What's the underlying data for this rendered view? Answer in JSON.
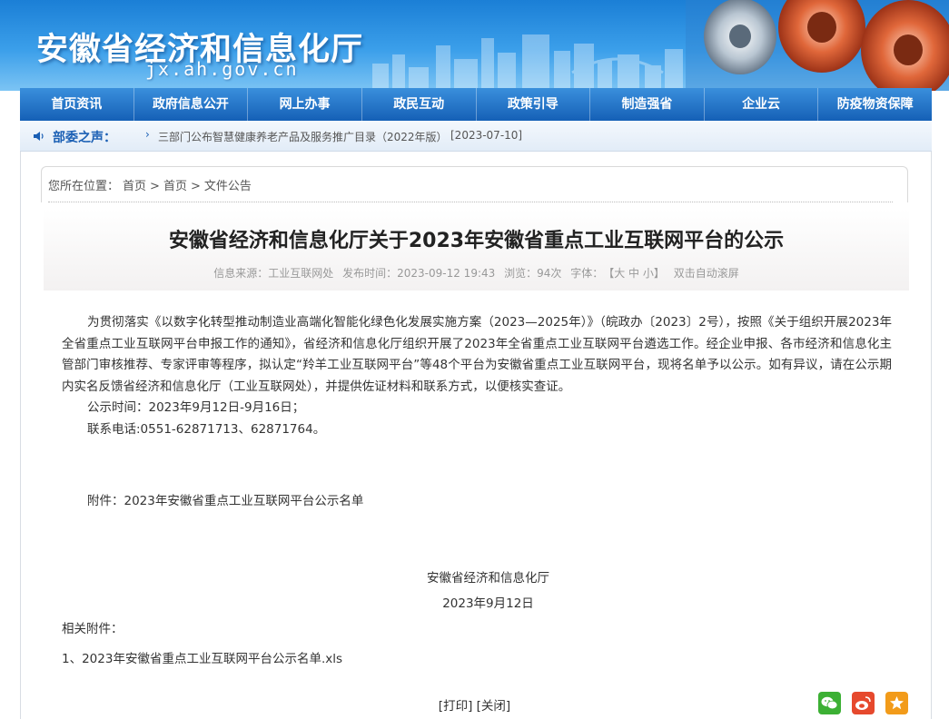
{
  "header": {
    "site_title": "安徽省经济和信息化厅",
    "domain": "jx.ah.gov.cn"
  },
  "nav": {
    "items": [
      "首页资讯",
      "政府信息公开",
      "网上办事",
      "政民互动",
      "政策引导",
      "制造强省",
      "企业云",
      "防疫物资保障"
    ]
  },
  "voice": {
    "label": "部委之声：",
    "arrow": "›",
    "text": "三部门公布智慧健康养老产品及服务推广目录（2022年版）",
    "date": "[2023-07-10]"
  },
  "breadcrumb": {
    "prefix": "您所在位置：",
    "items": [
      "首页",
      "首页",
      "文件公告"
    ],
    "separator": ">"
  },
  "article": {
    "title": "安徽省经济和信息化厅关于2023年安徽省重点工业互联网平台的公示",
    "meta": {
      "source": "信息来源：工业互联网处",
      "published": "发布时间：2023-09-12 19:43",
      "views": "浏览：94次",
      "font_label": "字体：",
      "font_sizes": "【大 中 小】",
      "autoscroll": "双击自动滚屏"
    },
    "paragraph1": "为贯彻落实《以数字化转型推动制造业高端化智能化绿色化发展实施方案（2023—2025年）》（皖政办〔2023〕2号），按照《关于组织开展2023年全省重点工业互联网平台申报工作的通知》，省经济和信息化厅组织开展了2023年全省重点工业互联网平台遴选工作。经企业申报、各市经济和信息化主管部门审核推荐、专家评审等程序，拟认定“羚羊工业互联网平台”等48个平台为安徽省重点工业互联网平台，现将名单予以公示。如有异议，请在公示期内实名反馈省经济和信息化厅（工业互联网处），并提供佐证材料和联系方式，以便核实查证。",
    "period": "公示时间：2023年9月12日-9月16日；",
    "phone": "联系电话:0551-62871713、62871764。",
    "attachment": "附件：2023年安徽省重点工业互联网平台公示名单",
    "sign_org": "安徽省经济和信息化厅",
    "sign_date": "2023年9月12日",
    "related_label": "相关附件：",
    "related_file": "1、2023年安徽省重点工业互联网平台公示名单.xls"
  },
  "actions": {
    "print": "[打印]",
    "close": "[关闭]"
  },
  "share": {
    "icons": [
      "wechat-icon",
      "weibo-icon",
      "favorite-icon"
    ],
    "colors": {
      "wechat": "#3cb034",
      "weibo": "#e6492d",
      "favorite": "#f29b1a"
    }
  },
  "colors": {
    "nav_bg": "#1560b6",
    "header_bg": "#1b7fd6",
    "voice_label": "#1a5fb4"
  }
}
